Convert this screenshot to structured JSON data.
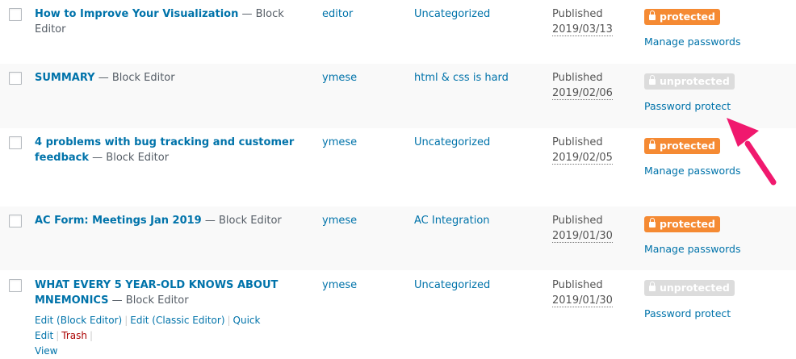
{
  "rows": [
    {
      "title": "How to Improve Your Visualization",
      "title_line2": "",
      "state": " — Block Editor",
      "author": "editor",
      "category": "Uncategorized",
      "status": "Published",
      "date": "2019/03/13",
      "badge": "protected",
      "link": "Manage passwords"
    },
    {
      "title": "SUMMARY",
      "title_line2": "",
      "state": " — Block Editor",
      "author": "ymese",
      "category": "html & css is hard",
      "status": "Published",
      "date": "2019/02/06",
      "badge": "unprotected",
      "link": "Password protect"
    },
    {
      "title": "4 problems with bug tracking and customer",
      "title_line2": "feedback",
      "state": " — Block Editor",
      "author": "ymese",
      "category": "Uncategorized",
      "status": "Published",
      "date": "2019/02/05",
      "badge": "protected",
      "link": "Manage passwords"
    },
    {
      "title": "AC Form: Meetings Jan 2019",
      "title_line2": "",
      "state": " — Block Editor",
      "author": "ymese",
      "category": "AC Integration",
      "status": "Published",
      "date": "2019/01/30",
      "badge": "protected",
      "link": "Manage passwords"
    },
    {
      "title": "WHAT EVERY 5 YEAR-OLD KNOWS ABOUT",
      "title_line2": "MNEMONICS",
      "state": " — Block Editor",
      "author": "ymese",
      "category": "Uncategorized",
      "status": "Published",
      "date": "2019/01/30",
      "badge": "unprotected",
      "link": "Password protect"
    }
  ],
  "row_actions": {
    "edit_block": "Edit (Block Editor)",
    "edit_classic": "Edit (Classic Editor)",
    "quick_edit": "Quick Edit",
    "trash": "Trash",
    "view": "View",
    "separator": "|"
  },
  "colors": {
    "link": "#0073aa",
    "protected_badge": "#f58a33",
    "unprotected_badge": "#dcdcdc",
    "annotation_arrow": "#f0196e",
    "trash": "#aa0000"
  },
  "icons": {
    "badge": "lock-icon",
    "annotation": "arrow-pointer"
  }
}
